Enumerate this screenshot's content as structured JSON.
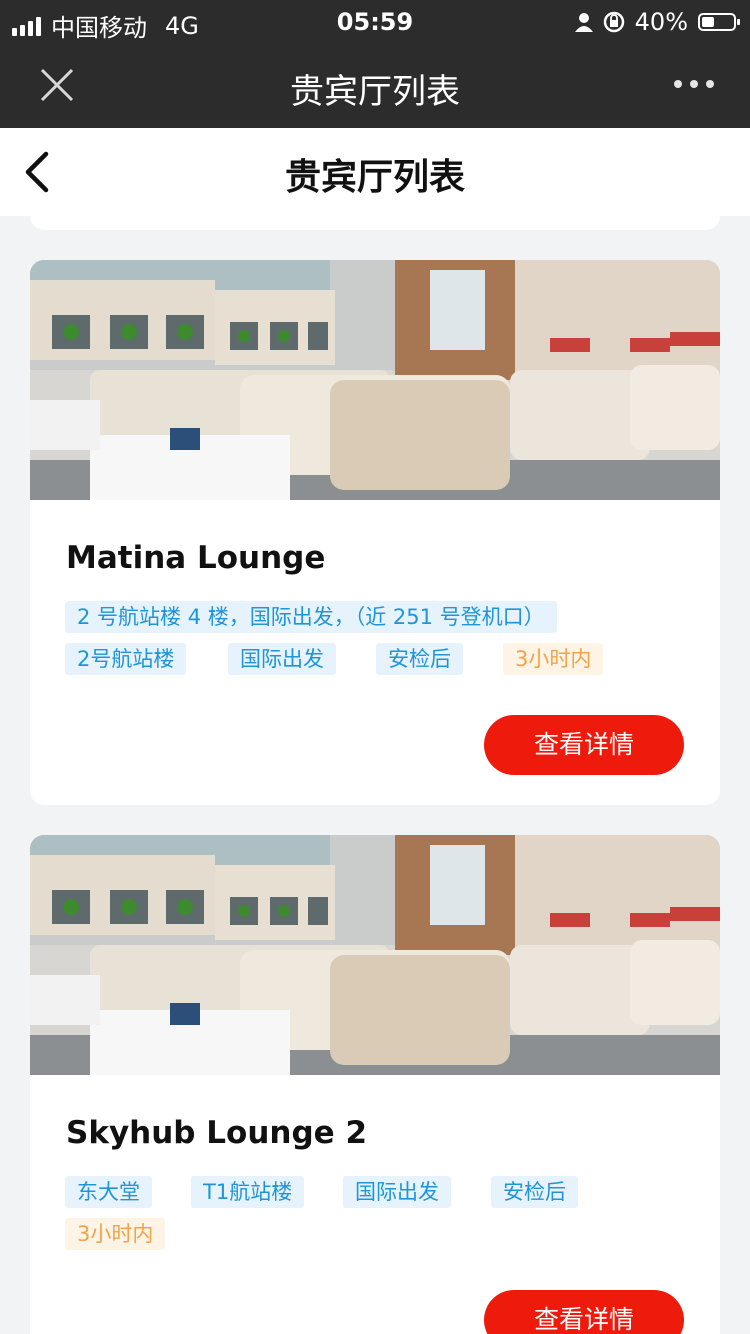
{
  "status_bar": {
    "carrier": "中国移动",
    "network": "4G",
    "time": "05:59",
    "battery": "40%",
    "battery_level": 0.4
  },
  "title_bar": {
    "title": "贵宾厅列表"
  },
  "page_header": {
    "title": "贵宾厅列表"
  },
  "lounges": [
    {
      "name": "Matina Lounge",
      "location": "2 号航站楼 4 楼，国际出发，（近 251 号登机口）",
      "tags": [
        "2号航站楼",
        "国际出发",
        "安检后"
      ],
      "duration_tag": "3小时内",
      "button_label": "查看详情"
    },
    {
      "name": "Skyhub Lounge 2",
      "tags": [
        "东大堂",
        "T1航站楼",
        "国际出发",
        "安检后"
      ],
      "duration_tag": "3小时内",
      "button_label": "查看详情"
    }
  ],
  "colors": {
    "button_red": "#ee1b0c",
    "tag_blue": "#1f95d8",
    "tag_orange": "#f0a34a"
  }
}
